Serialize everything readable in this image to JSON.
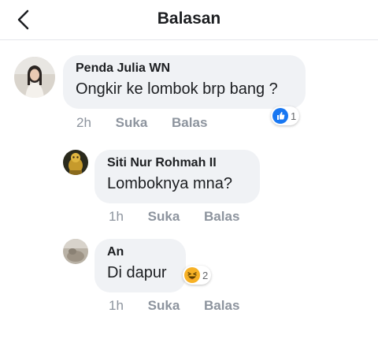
{
  "header": {
    "title": "Balasan",
    "back_icon": "chevron-left-icon"
  },
  "comments": [
    {
      "author": "Penda Julia WN",
      "text": "Ongkir ke lombok brp bang ?",
      "time": "2h",
      "like_label": "Suka",
      "reply_label": "Balas",
      "reaction": {
        "icon": "thumbs-up-icon",
        "count": "1",
        "color": "#1877f2"
      }
    },
    {
      "author": "Siti Nur Rohmah II",
      "text": "Lomboknya mna?",
      "time": "1h",
      "like_label": "Suka",
      "reply_label": "Balas"
    },
    {
      "author": "An",
      "text": "Di dapur",
      "time": "1h",
      "like_label": "Suka",
      "reply_label": "Balas",
      "reaction": {
        "icon": "laughing-face-icon",
        "count": "2",
        "color": "#f7b125"
      }
    }
  ]
}
